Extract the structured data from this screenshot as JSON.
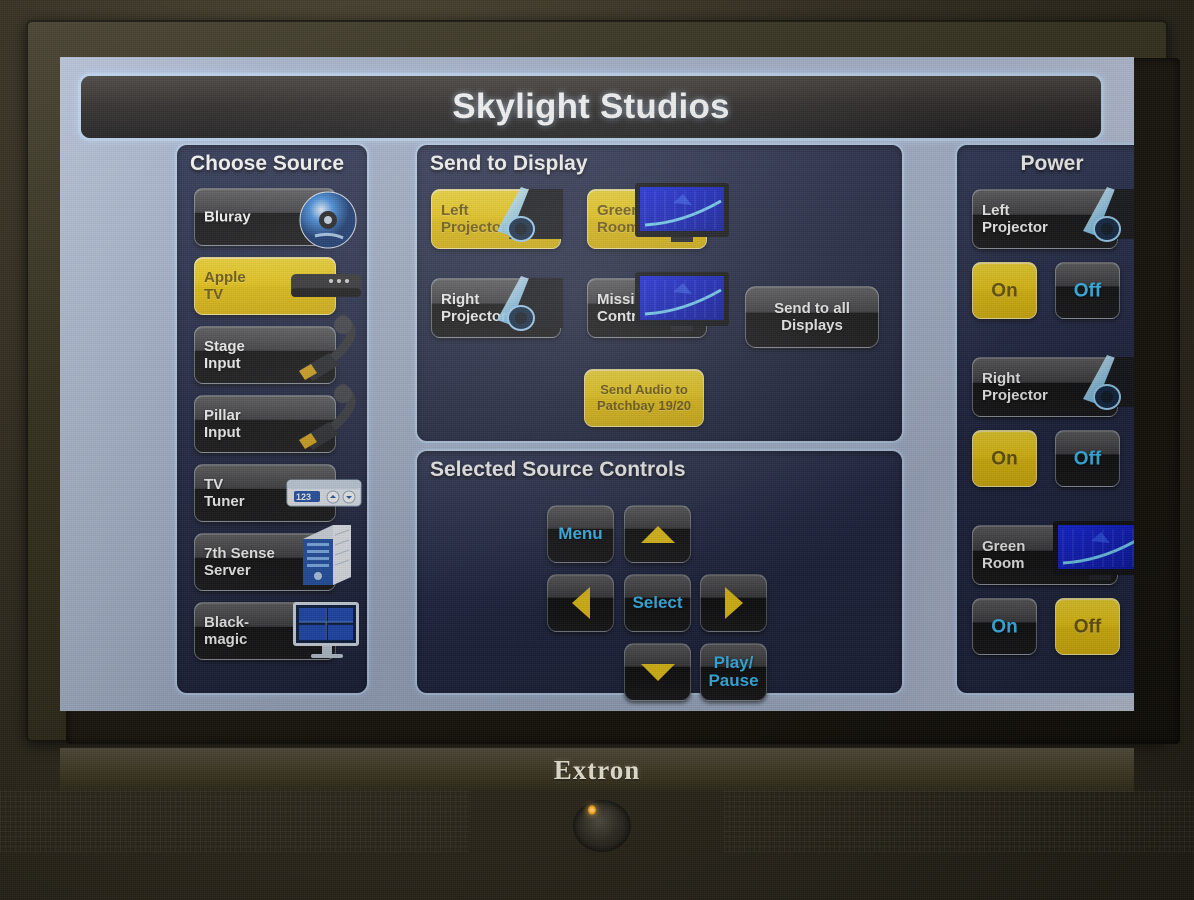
{
  "device": {
    "brand": "Extron",
    "bezel_color": "#33301f",
    "screen_bg": "#a6b4ce"
  },
  "header": {
    "title": "Skylight Studios"
  },
  "colors": {
    "active": "#f1cc0d",
    "active_text": "#6b5404",
    "panel_bg": "#1b2240",
    "panel_border": "#b8cfec",
    "label_cyan": "#36c3ff"
  },
  "source_panel": {
    "title": "Choose Source",
    "items": [
      {
        "label": "Bluray",
        "icon": "bluray-disc-icon",
        "active": false
      },
      {
        "label": "Apple\nTV",
        "icon": "apple-tv-box-icon",
        "active": true
      },
      {
        "label": "Stage\nInput",
        "icon": "hdmi-cable-icon",
        "active": false
      },
      {
        "label": "Pillar\nInput",
        "icon": "hdmi-cable-icon",
        "active": false
      },
      {
        "label": "TV\nTuner",
        "icon": "tv-tuner-icon",
        "active": false
      },
      {
        "label": "7th Sense\nServer",
        "icon": "server-tower-icon",
        "active": false
      },
      {
        "label": "Black-\nmagic",
        "icon": "multiview-monitor-icon",
        "active": false
      }
    ]
  },
  "send_panel": {
    "title": "Send to Display",
    "destinations": [
      {
        "label": "Left\nProjector",
        "icon": "projector-icon",
        "active": true
      },
      {
        "label": "Green\nRoom",
        "icon": "monitor-icon",
        "active": true
      },
      {
        "label": "Right\nProjector",
        "icon": "projector-icon",
        "active": false
      },
      {
        "label": "Mission\nControl",
        "icon": "monitor-icon",
        "active": false
      }
    ],
    "send_all_label": "Send to all\nDisplays",
    "audio_label": "Send Audio to\nPatchbay 19/20",
    "audio_active": true
  },
  "controls_panel": {
    "title": "Selected Source Controls",
    "buttons": [
      {
        "name": "menu",
        "label": "Menu",
        "icon": null
      },
      {
        "name": "up",
        "label": "",
        "icon": "arrow-up-icon"
      },
      {
        "name": "left",
        "label": "",
        "icon": "arrow-left-icon"
      },
      {
        "name": "select",
        "label": "Select",
        "icon": null
      },
      {
        "name": "right",
        "label": "",
        "icon": "arrow-right-icon"
      },
      {
        "name": "down",
        "label": "",
        "icon": "arrow-down-icon"
      },
      {
        "name": "play_pause",
        "label": "Play/\nPause",
        "icon": null
      }
    ]
  },
  "power_panel": {
    "title": "Power",
    "groups": [
      {
        "device": "Left\nProjector",
        "icon": "projector-icon",
        "on_label": "On",
        "off_label": "Off",
        "state": "on"
      },
      {
        "device": "Right\nProjector",
        "icon": "projector-icon",
        "on_label": "On",
        "off_label": "Off",
        "state": "on"
      },
      {
        "device": "Green\nRoom",
        "icon": "monitor-icon",
        "on_label": "On",
        "off_label": "Off",
        "state": "off"
      }
    ]
  }
}
